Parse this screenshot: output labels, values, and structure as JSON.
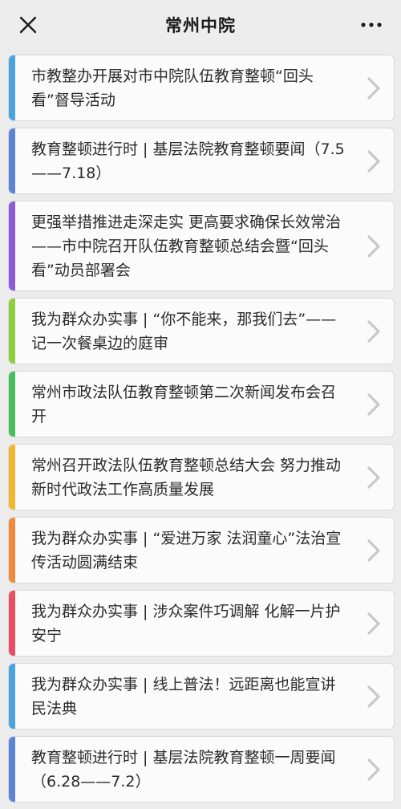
{
  "header": {
    "title": "常州中院"
  },
  "icons": {
    "close": "close-icon",
    "more": "more-dots-icon",
    "arrow": "chevron-right-icon"
  },
  "colors": {
    "background": "#ececec",
    "card_bg": "#fbfbfb",
    "arrow": "#c8c8c8"
  },
  "articles": [
    {
      "title": "市教整办开展对市中院队伍教育整顿“回头看”督导活动",
      "accent": "#4aa3df"
    },
    {
      "title": "教育整顿进行时 | 基层法院教育整顿要闻（7.5——7.18）",
      "accent": "#5b84d6"
    },
    {
      "title": "更强举措推进走深走实 更高要求确保长效常治——市中院召开队伍教育整顿总结会暨“回头看”动员部署会",
      "accent": "#8c5bd6"
    },
    {
      "title": "我为群众办实事 | “你不能来，那我们去”——记一次餐桌边的庭审",
      "accent": "#8ccf3f"
    },
    {
      "title": "常州市政法队伍教育整顿第二次新闻发布会召开",
      "accent": "#47c05a"
    },
    {
      "title": "常州召开政法队伍教育整顿总结大会 努力推动新时代政法工作高质量发展",
      "accent": "#f0b72f"
    },
    {
      "title": "我为群众办实事 | “爱进万家 法润童心”法治宣传活动圆满结束",
      "accent": "#f08a3e"
    },
    {
      "title": "我为群众办实事 | 涉众案件巧调解 化解一片护安宁",
      "accent": "#e94e63"
    },
    {
      "title": "我为群众办实事 | 线上普法！远距离也能宣讲民法典",
      "accent": "#4aa3df"
    },
    {
      "title": "教育整顿进行时 | 基层法院教育整顿一周要闻（6.28——7.2）",
      "accent": "#5b84d6"
    }
  ]
}
